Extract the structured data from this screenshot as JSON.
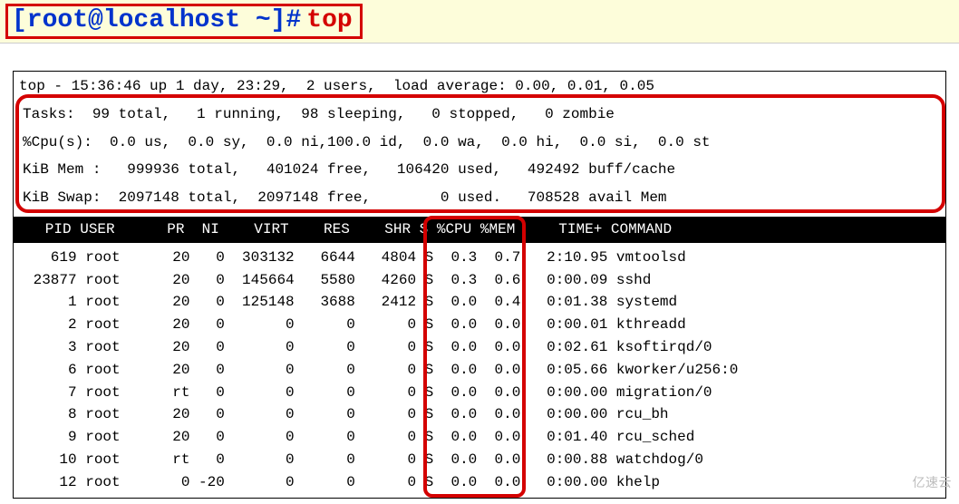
{
  "shell": {
    "prompt": "[root@localhost ~]#",
    "command": "top"
  },
  "top_header": {
    "line": "top - 15:36:46 up 1 day, 23:29,  2 users,  load average: 0.00, 0.01, 0.05",
    "time": "15:36:46",
    "uptime": "1 day, 23:29",
    "users": 2,
    "load_avg": [
      0.0,
      0.01,
      0.05
    ]
  },
  "tasks": {
    "line": "Tasks:  99 total,   1 running,  98 sleeping,   0 stopped,   0 zombie",
    "total": 99,
    "running": 1,
    "sleeping": 98,
    "stopped": 0,
    "zombie": 0
  },
  "cpu": {
    "line": "%Cpu(s):  0.0 us,  0.0 sy,  0.0 ni,100.0 id,  0.0 wa,  0.0 hi,  0.0 si,  0.0 st",
    "us": 0.0,
    "sy": 0.0,
    "ni": 0.0,
    "id": 100.0,
    "wa": 0.0,
    "hi": 0.0,
    "si": 0.0,
    "st": 0.0
  },
  "mem": {
    "line": "KiB Mem :   999936 total,   401024 free,   106420 used,   492492 buff/cache",
    "total": 999936,
    "free": 401024,
    "used": 106420,
    "buff_cache": 492492
  },
  "swap": {
    "line": "KiB Swap:  2097148 total,  2097148 free,        0 used.   708528 avail Mem",
    "total": 2097148,
    "free": 2097148,
    "used": 0,
    "avail_mem": 708528
  },
  "columns": {
    "line": "   PID USER      PR  NI    VIRT    RES    SHR S %CPU %MEM     TIME+ COMMAND",
    "names": [
      "PID",
      "USER",
      "PR",
      "NI",
      "VIRT",
      "RES",
      "SHR",
      "S",
      "%CPU",
      "%MEM",
      "TIME+",
      "COMMAND"
    ]
  },
  "processes": [
    {
      "pid": 619,
      "user": "root",
      "pr": "20",
      "ni": "0",
      "virt": "303132",
      "res": "6644",
      "shr": "4804",
      "s": "S",
      "cpu": "0.3",
      "mem": "0.7",
      "time": "2:10.95",
      "cmd": "vmtoolsd",
      "line": "   619 root      20   0  303132   6644   4804 S  0.3  0.7   2:10.95 vmtoolsd"
    },
    {
      "pid": 23877,
      "user": "root",
      "pr": "20",
      "ni": "0",
      "virt": "145664",
      "res": "5580",
      "shr": "4260",
      "s": "S",
      "cpu": "0.3",
      "mem": "0.6",
      "time": "0:00.09",
      "cmd": "sshd",
      "line": " 23877 root      20   0  145664   5580   4260 S  0.3  0.6   0:00.09 sshd"
    },
    {
      "pid": 1,
      "user": "root",
      "pr": "20",
      "ni": "0",
      "virt": "125148",
      "res": "3688",
      "shr": "2412",
      "s": "S",
      "cpu": "0.0",
      "mem": "0.4",
      "time": "0:01.38",
      "cmd": "systemd",
      "line": "     1 root      20   0  125148   3688   2412 S  0.0  0.4   0:01.38 systemd"
    },
    {
      "pid": 2,
      "user": "root",
      "pr": "20",
      "ni": "0",
      "virt": "0",
      "res": "0",
      "shr": "0",
      "s": "S",
      "cpu": "0.0",
      "mem": "0.0",
      "time": "0:00.01",
      "cmd": "kthreadd",
      "line": "     2 root      20   0       0      0      0 S  0.0  0.0   0:00.01 kthreadd"
    },
    {
      "pid": 3,
      "user": "root",
      "pr": "20",
      "ni": "0",
      "virt": "0",
      "res": "0",
      "shr": "0",
      "s": "S",
      "cpu": "0.0",
      "mem": "0.0",
      "time": "0:02.61",
      "cmd": "ksoftirqd/0",
      "line": "     3 root      20   0       0      0      0 S  0.0  0.0   0:02.61 ksoftirqd/0"
    },
    {
      "pid": 6,
      "user": "root",
      "pr": "20",
      "ni": "0",
      "virt": "0",
      "res": "0",
      "shr": "0",
      "s": "S",
      "cpu": "0.0",
      "mem": "0.0",
      "time": "0:05.66",
      "cmd": "kworker/u256:0",
      "line": "     6 root      20   0       0      0      0 S  0.0  0.0   0:05.66 kworker/u256:0"
    },
    {
      "pid": 7,
      "user": "root",
      "pr": "rt",
      "ni": "0",
      "virt": "0",
      "res": "0",
      "shr": "0",
      "s": "S",
      "cpu": "0.0",
      "mem": "0.0",
      "time": "0:00.00",
      "cmd": "migration/0",
      "line": "     7 root      rt   0       0      0      0 S  0.0  0.0   0:00.00 migration/0"
    },
    {
      "pid": 8,
      "user": "root",
      "pr": "20",
      "ni": "0",
      "virt": "0",
      "res": "0",
      "shr": "0",
      "s": "S",
      "cpu": "0.0",
      "mem": "0.0",
      "time": "0:00.00",
      "cmd": "rcu_bh",
      "line": "     8 root      20   0       0      0      0 S  0.0  0.0   0:00.00 rcu_bh"
    },
    {
      "pid": 9,
      "user": "root",
      "pr": "20",
      "ni": "0",
      "virt": "0",
      "res": "0",
      "shr": "0",
      "s": "S",
      "cpu": "0.0",
      "mem": "0.0",
      "time": "0:01.40",
      "cmd": "rcu_sched",
      "line": "     9 root      20   0       0      0      0 S  0.0  0.0   0:01.40 rcu_sched"
    },
    {
      "pid": 10,
      "user": "root",
      "pr": "rt",
      "ni": "0",
      "virt": "0",
      "res": "0",
      "shr": "0",
      "s": "S",
      "cpu": "0.0",
      "mem": "0.0",
      "time": "0:00.88",
      "cmd": "watchdog/0",
      "line": "    10 root      rt   0       0      0      0 S  0.0  0.0   0:00.88 watchdog/0"
    },
    {
      "pid": 12,
      "user": "root",
      "pr": "0",
      "ni": "-20",
      "virt": "0",
      "res": "0",
      "shr": "0",
      "s": "S",
      "cpu": "0.0",
      "mem": "0.0",
      "time": "0:00.00",
      "cmd": "khelp",
      "line": "    12 root       0 -20       0      0      0 S  0.0  0.0   0:00.00 khelp"
    }
  ],
  "highlight": {
    "summary_lines": [
      "tasks",
      "cpu",
      "mem",
      "swap"
    ],
    "columns_box": [
      "%CPU",
      "%MEM"
    ]
  },
  "watermark": "亿速云"
}
